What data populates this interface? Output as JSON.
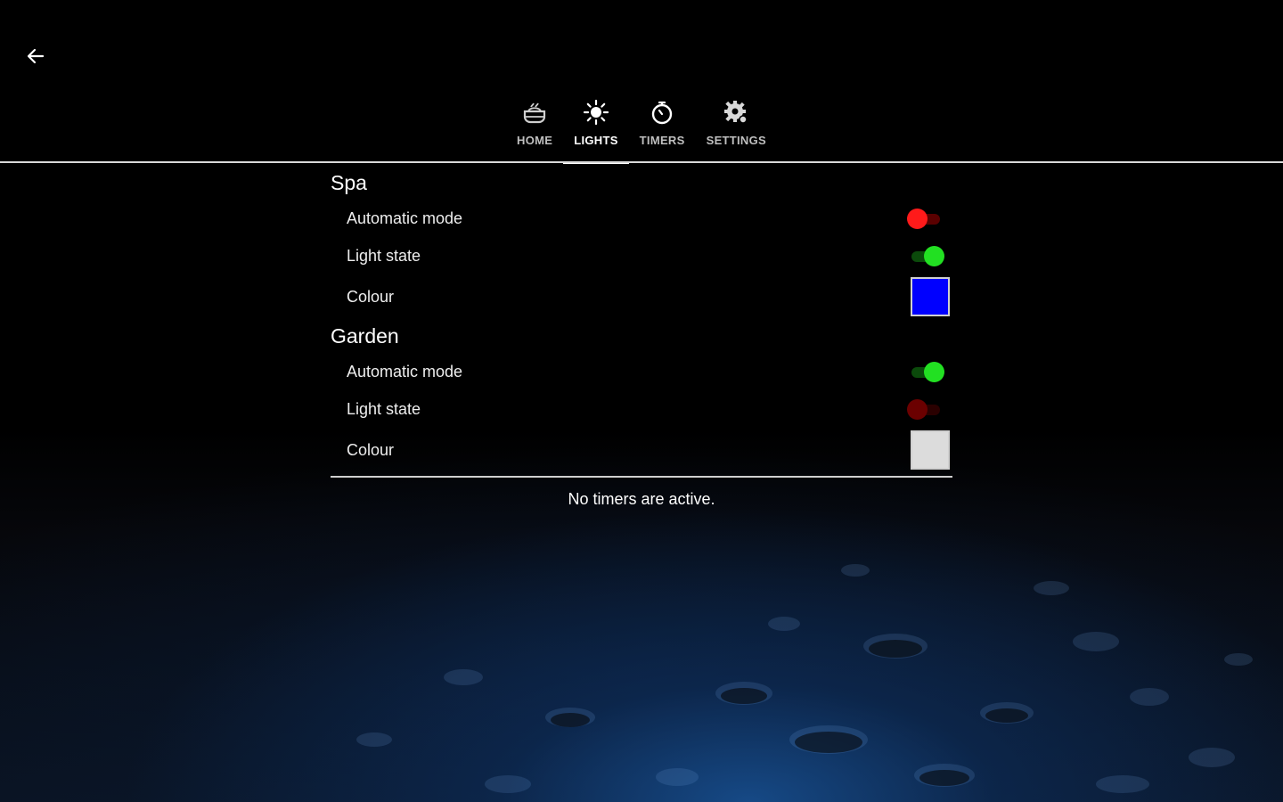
{
  "tabs": [
    {
      "label": "HOME",
      "icon": "hot-tub-icon",
      "active": false
    },
    {
      "label": "LIGHTS",
      "icon": "sun-icon",
      "active": true
    },
    {
      "label": "TIMERS",
      "icon": "stopwatch-icon",
      "active": false
    },
    {
      "label": "SETTINGS",
      "icon": "gear-icon",
      "active": false
    }
  ],
  "groups": [
    {
      "title": "Spa",
      "automatic_mode": {
        "label": "Automatic mode",
        "state": "off",
        "thumb_color": "#ff1a1a",
        "track_color": "#5a0000"
      },
      "light_state": {
        "label": "Light state",
        "state": "on",
        "thumb_color": "#22e022",
        "track_color": "#0b4a0b"
      },
      "colour": {
        "label": "Colour",
        "value": "#0000ff"
      }
    },
    {
      "title": "Garden",
      "automatic_mode": {
        "label": "Automatic mode",
        "state": "on",
        "thumb_color": "#22e022",
        "track_color": "#0b4a0b"
      },
      "light_state": {
        "label": "Light state",
        "state": "off",
        "thumb_color": "#6b0000",
        "track_color": "#2a0000"
      },
      "colour": {
        "label": "Colour",
        "value": "#dcdcdc"
      }
    }
  ],
  "timers": {
    "empty_message": "No timers are active."
  }
}
